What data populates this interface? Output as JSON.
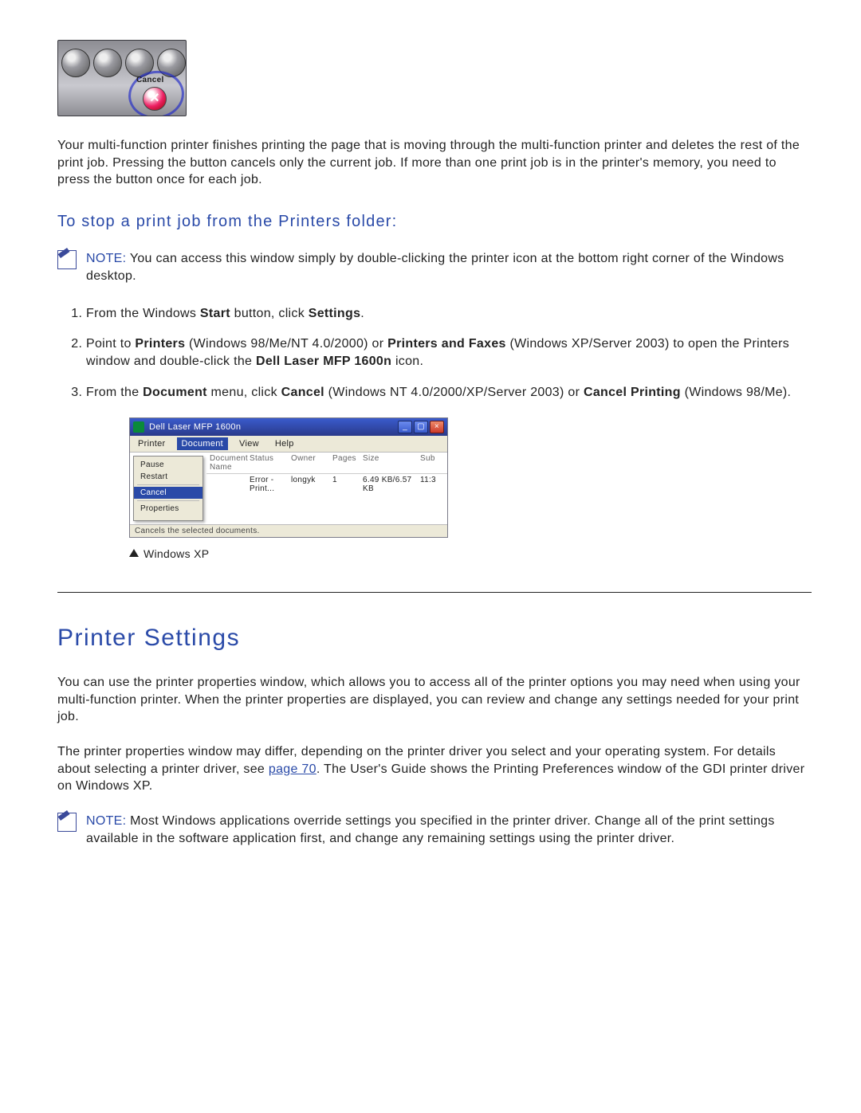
{
  "figure1": {
    "label": "Cancel",
    "x_glyph": "✕"
  },
  "intro_para": "Your multi-function printer finishes printing the page that is moving through the multi-function printer and deletes the rest of the print job. Pressing the button cancels only the current job. If more than one print job is in the printer's memory, you need to press the button once for each job.",
  "subheading": "To stop a print job from the Printers folder:",
  "note1": {
    "label": "NOTE:",
    "text": " You can access this window simply by double-clicking the printer icon at the bottom right corner of the Windows desktop."
  },
  "steps": {
    "s1_a": "From the Windows ",
    "s1_b": "Start",
    "s1_c": " button, click ",
    "s1_d": "Settings",
    "s1_e": ".",
    "s2_a": "Point to ",
    "s2_b": "Printers",
    "s2_c": " (Windows 98/Me/NT 4.0/2000) or ",
    "s2_d": "Printers and Faxes",
    "s2_e": " (Windows XP/Server 2003) to open the Printers window and double-click the ",
    "s2_f": "Dell Laser MFP 1600n",
    "s2_g": " icon.",
    "s3_a": "From the ",
    "s3_b": "Document",
    "s3_c": " menu, click ",
    "s3_d": "Cancel",
    "s3_e": " (Windows NT 4.0/2000/XP/Server 2003) or ",
    "s3_f": "Cancel Printing",
    "s3_g": " (Windows 98/Me)."
  },
  "figure2": {
    "title": "Dell Laser MFP 1600n",
    "menu": {
      "printer": "Printer",
      "document": "Document",
      "view": "View",
      "help": "Help"
    },
    "dropdown": {
      "pause": "Pause",
      "restart": "Restart",
      "cancel": "Cancel",
      "properties": "Properties"
    },
    "header": {
      "name": "Document Name",
      "status": "Status",
      "owner": "Owner",
      "pages": "Pages",
      "size": "Size",
      "sub": "Sub"
    },
    "row": {
      "name": "",
      "status": "Error - Print...",
      "owner": "longyk",
      "pages": "1",
      "size": "6.49 KB/6.57 KB",
      "sub": "11:3"
    },
    "statusbar": "Cancels the selected documents.",
    "caption": "Windows XP"
  },
  "section_heading": "Printer Settings",
  "ps_para1": "You can use the printer properties window, which allows you to access all of the printer options you may need when using your multi-function printer. When the printer properties are displayed, you can review and change any settings needed for your print job.",
  "ps_para2_a": "The printer properties window may differ, depending on the printer driver you select and your operating system. For details about selecting a printer driver, see ",
  "ps_para2_link": "page 70",
  "ps_para2_b": ". The User's Guide shows the Printing Preferences window of the GDI printer driver on Windows XP.",
  "note2": {
    "label": "NOTE:",
    "text": " Most Windows applications override settings you specified in the printer driver. Change all of the print settings available in the software application first, and change any remaining settings using the printer driver."
  }
}
